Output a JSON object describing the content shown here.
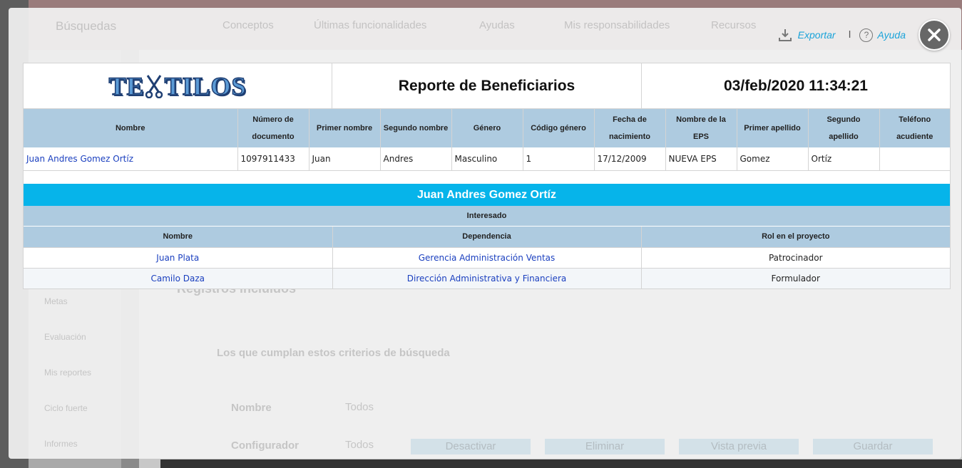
{
  "background": {
    "nav_items": [
      "Búsquedas",
      "Conceptos",
      "Últimas funcionalidades",
      "Ayudas",
      "Mis responsabilidades",
      "Recursos"
    ],
    "section_title": "Registros incluidos",
    "criteria_label": "Los que cumplan estos criterios de búsqueda",
    "sidebar_items": [
      "Metas",
      "Evaluación",
      "Mis reportes",
      "Ciclo fuerte",
      "Informes"
    ],
    "filter_name_label": "Nombre",
    "filter_name_value": "Todos",
    "filter_config_label": "Configurador",
    "filter_config_value": "Todos",
    "buttons": [
      "Desactivar",
      "Eliminar",
      "Vista previa",
      "Guardar"
    ]
  },
  "toolbar": {
    "export_label": "Exportar",
    "separator": "I",
    "help_label": "Ayuda",
    "help_symbol": "?",
    "accent_color": "#1aa3d9"
  },
  "report": {
    "logo_left": "TE",
    "logo_right": "TILOS",
    "title": "Reporte de Beneficiarios",
    "datetime": "03/feb/2020 11:34:21",
    "columns": [
      "Nombre",
      "Número de documento",
      "Primer nombre",
      "Segundo nombre",
      "Género",
      "Código género",
      "Fecha de nacimiento",
      "Nombre de la EPS",
      "Primer apellido",
      "Segundo apellido",
      "Teléfono acudiente"
    ],
    "rows": [
      [
        "Juan Andres Gomez Ortíz",
        "1097911433",
        "Juan",
        "Andres",
        "Masculino",
        "1",
        "17/12/2009",
        "NUEVA EPS",
        "Gomez",
        "Ortíz",
        ""
      ]
    ]
  },
  "detail": {
    "title": "Juan Andres Gomez Ortíz",
    "group_label": "Interesado",
    "columns": [
      "Nombre",
      "Dependencia",
      "Rol en el proyecto"
    ],
    "rows": [
      [
        "Juan Plata",
        "Gerencia Administración Ventas",
        "Patrocinador"
      ],
      [
        "Camilo Daza",
        "Dirección Administrativa y Financiera",
        "Formulador"
      ]
    ],
    "header_color": "#06b4ea"
  }
}
